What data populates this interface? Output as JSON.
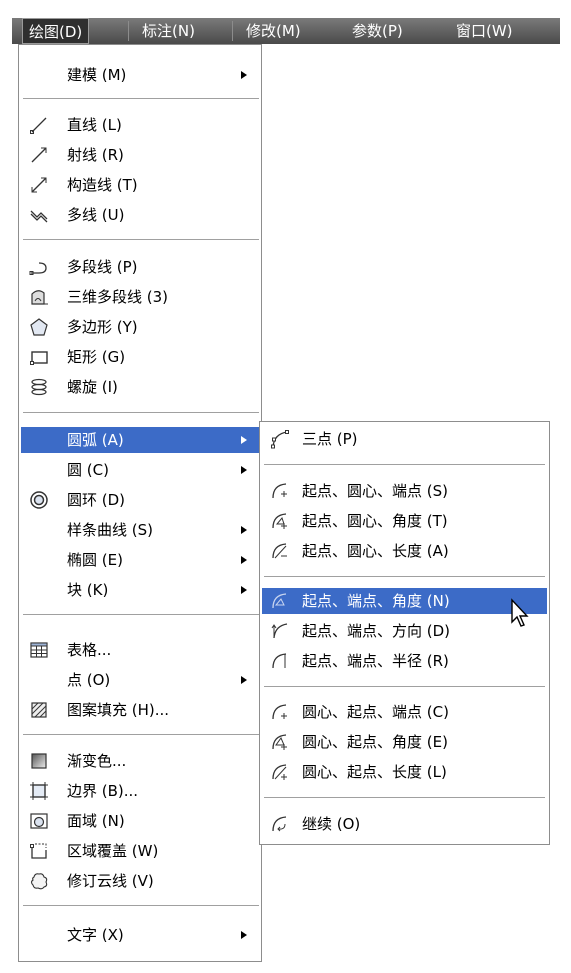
{
  "menubar": {
    "items": [
      "绘图(D)",
      "标注(N)",
      "修改(M)",
      "参数(P)",
      "窗口(W)"
    ]
  },
  "draw_menu": {
    "items": [
      {
        "label": "建模 (M)",
        "has_submenu": true
      },
      {
        "label": "直线 (L)",
        "icon": "line-icon"
      },
      {
        "label": "射线 (R)",
        "icon": "ray-icon"
      },
      {
        "label": "构造线 (T)",
        "icon": "construction-line-icon"
      },
      {
        "label": "多线 (U)",
        "icon": "multiline-icon"
      },
      {
        "label": "多段线 (P)",
        "icon": "polyline-icon"
      },
      {
        "label": "三维多段线 (3)",
        "icon": "3d-polyline-icon"
      },
      {
        "label": "多边形 (Y)",
        "icon": "polygon-icon"
      },
      {
        "label": "矩形 (G)",
        "icon": "rectangle-icon"
      },
      {
        "label": "螺旋 (I)",
        "icon": "helix-icon"
      },
      {
        "label": "圆弧 (A)",
        "has_submenu": true,
        "highlighted": true
      },
      {
        "label": "圆 (C)",
        "has_submenu": true
      },
      {
        "label": "圆环 (D)",
        "icon": "donut-icon"
      },
      {
        "label": "样条曲线 (S)",
        "has_submenu": true
      },
      {
        "label": "椭圆 (E)",
        "has_submenu": true
      },
      {
        "label": "块 (K)",
        "has_submenu": true
      },
      {
        "label": "表格...",
        "icon": "table-icon"
      },
      {
        "label": "点 (O)",
        "has_submenu": true
      },
      {
        "label": "图案填充 (H)...",
        "icon": "hatch-icon"
      },
      {
        "label": "渐变色...",
        "icon": "gradient-icon"
      },
      {
        "label": "边界 (B)...",
        "icon": "boundary-icon"
      },
      {
        "label": "面域 (N)",
        "icon": "region-icon"
      },
      {
        "label": "区域覆盖 (W)",
        "icon": "wipeout-icon"
      },
      {
        "label": "修订云线 (V)",
        "icon": "revcloud-icon"
      },
      {
        "label": "文字 (X)",
        "has_submenu": true
      }
    ]
  },
  "arc_submenu": {
    "items": [
      {
        "label": "三点 (P)",
        "icon": "arc-3point-icon"
      },
      {
        "label": "起点、圆心、端点 (S)",
        "icon": "arc-sce-icon"
      },
      {
        "label": "起点、圆心、角度 (T)",
        "icon": "arc-sca-icon"
      },
      {
        "label": "起点、圆心、长度 (A)",
        "icon": "arc-scl-icon"
      },
      {
        "label": "起点、端点、角度 (N)",
        "icon": "arc-sea-icon",
        "highlighted": true
      },
      {
        "label": "起点、端点、方向 (D)",
        "icon": "arc-sed-icon"
      },
      {
        "label": "起点、端点、半径 (R)",
        "icon": "arc-ser-icon"
      },
      {
        "label": "圆心、起点、端点 (C)",
        "icon": "arc-cse-icon"
      },
      {
        "label": "圆心、起点、角度 (E)",
        "icon": "arc-csa-icon"
      },
      {
        "label": "圆心、起点、长度 (L)",
        "icon": "arc-csl-icon"
      },
      {
        "label": "继续 (O)",
        "icon": "arc-continue-icon"
      }
    ]
  },
  "colors": {
    "highlight": "#3c6bc7",
    "menubar": "#5a5a5a"
  }
}
